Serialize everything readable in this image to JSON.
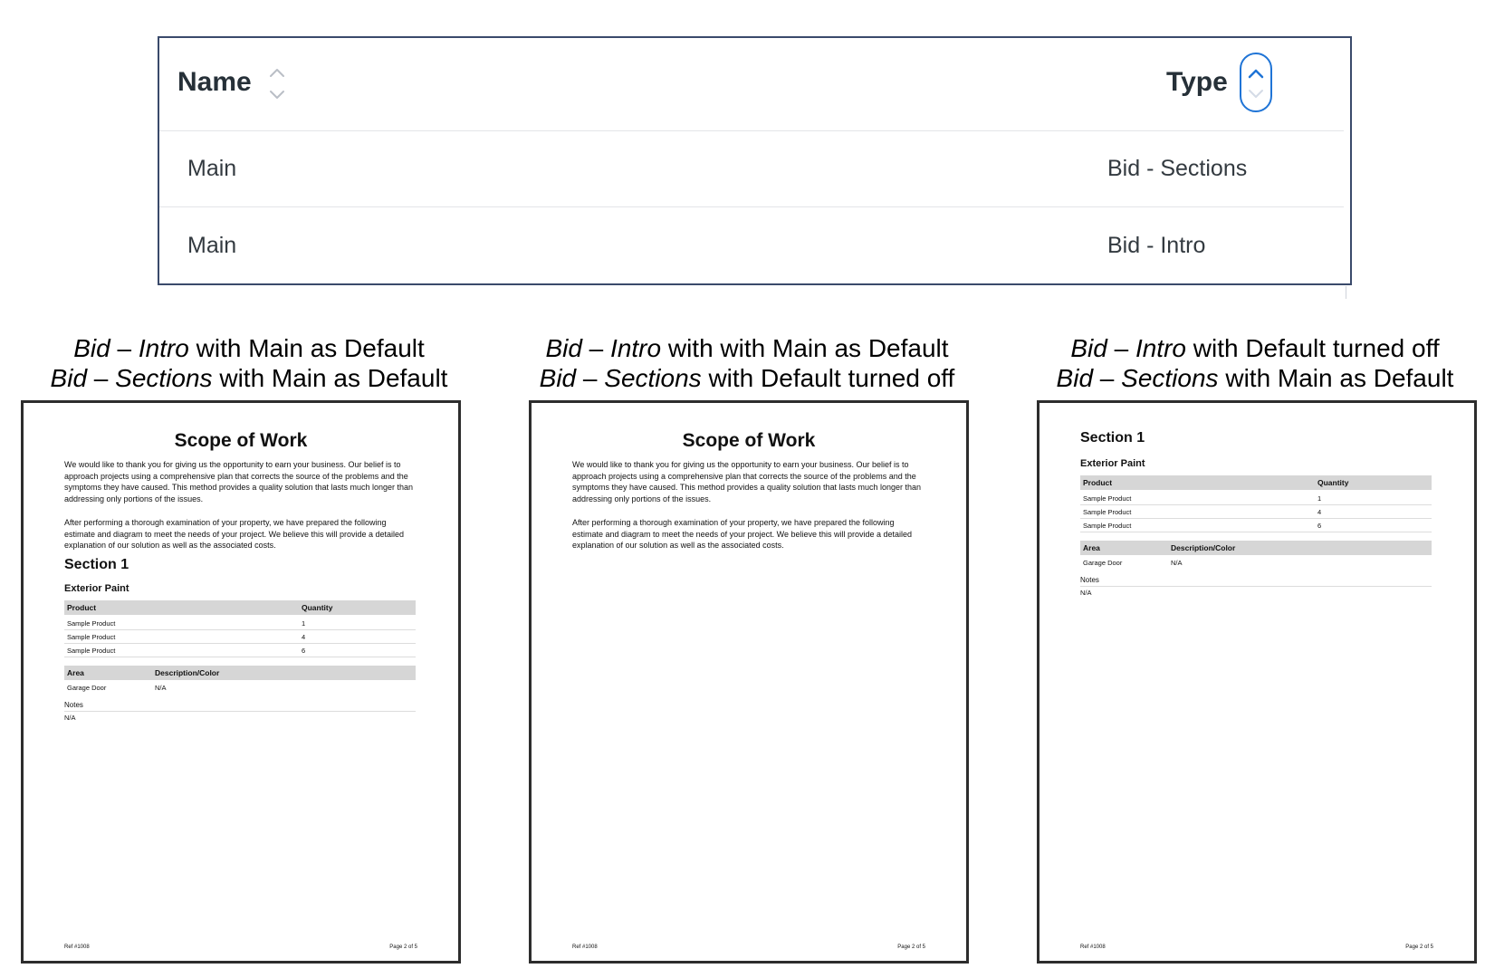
{
  "table": {
    "headers": {
      "name": "Name",
      "type": "Type"
    },
    "rows": [
      {
        "name": "Main",
        "type": "Bid - Sections"
      },
      {
        "name": "Main",
        "type": "Bid - Intro"
      }
    ],
    "sort_active_color": "#1f74d6"
  },
  "captions": [
    {
      "line1": {
        "a": "Bid",
        "dash": " – ",
        "b": "Intro",
        "rest": " with Main as Default"
      },
      "line2": {
        "a": "Bid",
        "dash": " – ",
        "b": "Sections",
        "rest": " with Main as Default"
      }
    },
    {
      "line1": {
        "a": "Bid",
        "dash": " – ",
        "b": "Intro",
        "rest": " with with Main as Default"
      },
      "line2": {
        "a": "Bid",
        "dash": " – ",
        "b": "Sections",
        "rest": " with Default turned off"
      }
    },
    {
      "line1": {
        "a": "Bid",
        "dash": " – ",
        "b": "Intro",
        "rest": " with Default turned off"
      },
      "line2": {
        "a": "Bid",
        "dash": " – ",
        "b": "Sections",
        "rest": " with Main as Default"
      }
    }
  ],
  "doc": {
    "scope_title": "Scope of Work",
    "para1": "We would like to thank you for giving us the opportunity to earn your business. Our belief is to approach projects using a comprehensive plan that corrects the source of the problems and the symptoms they have caused. This method provides a quality solution that lasts much longer than addressing only portions of the issues.",
    "para2": "After performing a thorough examination of your property, we have prepared the following estimate and diagram to meet the needs of your project. We believe this will provide a detailed explanation of our solution as well as the associated costs.",
    "section_title": "Section 1",
    "subsection_title": "Exterior Paint",
    "products_header": {
      "product": "Product",
      "quantity": "Quantity"
    },
    "products": [
      {
        "product": "Sample Product",
        "quantity": "1"
      },
      {
        "product": "Sample Product",
        "quantity": "4"
      },
      {
        "product": "Sample Product",
        "quantity": "6"
      }
    ],
    "area_header": {
      "area": "Area",
      "description": "Description/Color"
    },
    "areas": [
      {
        "area": "Garage Door",
        "description": "N/A"
      }
    ],
    "notes_label": "Notes",
    "notes_value": "N/A",
    "footer_ref": "Ref #1008",
    "footer_page": "Page 2 of 5"
  }
}
